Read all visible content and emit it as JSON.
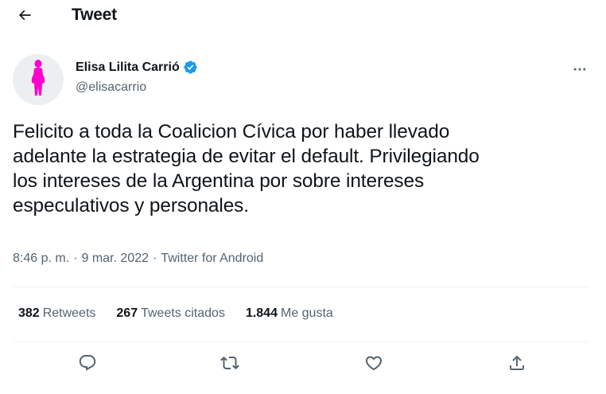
{
  "header": {
    "back_icon": "arrow-left-icon",
    "title": "Tweet"
  },
  "author": {
    "avatar_icon": "person-silhouette-icon",
    "avatar_color": "#ff00cc",
    "display_name": "Elisa Lilita Carrió",
    "verified_icon": "verified-badge-icon",
    "verified_color": "#1d9bf0",
    "handle": "@elisacarrio",
    "more_icon": "more-horizontal-icon"
  },
  "tweet": {
    "text": "Felicito a toda la Coalicion Cívica por haber llevado\nadelante la estrategia de evitar el default. Privilegiando\nlos intereses de la Argentina por sobre intereses\nespeculativos y personales."
  },
  "meta": {
    "time": "8:46 p. m.",
    "sep1": "·",
    "date": "9 mar. 2022",
    "sep2": "·",
    "source": "Twitter for Android"
  },
  "stats": {
    "retweets": {
      "count": "382",
      "label": "Retweets"
    },
    "quotes": {
      "count": "267",
      "label": "Tweets citados"
    },
    "likes": {
      "count": "1.844",
      "label": "Me gusta"
    }
  },
  "actions": {
    "reply_icon": "reply-bubble-icon",
    "retweet_icon": "retweet-icon",
    "like_icon": "heart-icon",
    "share_icon": "share-upload-icon"
  },
  "colors": {
    "text_primary": "#0f1419",
    "text_secondary": "#536471",
    "divider": "#eff3f4"
  }
}
